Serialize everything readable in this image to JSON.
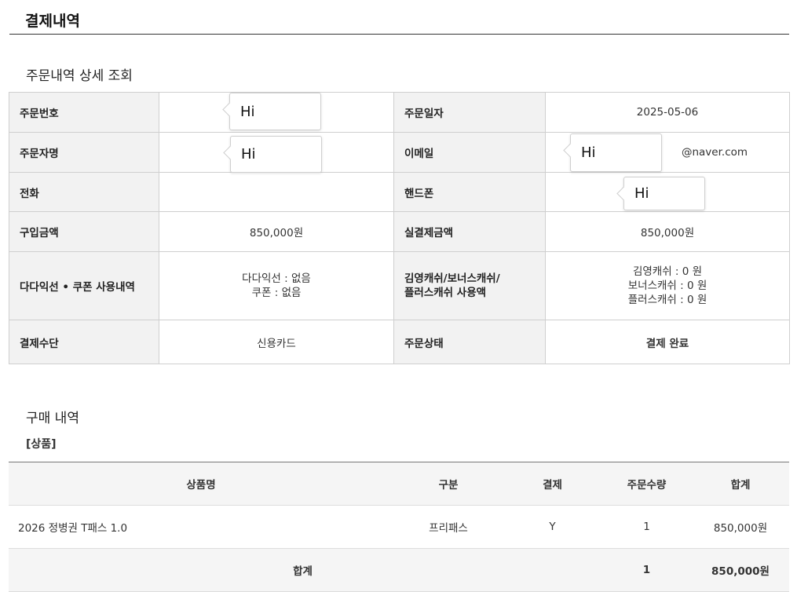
{
  "page_title": "결제내역",
  "section_title": "주문내역 상세 조회",
  "order": {
    "order_no_label": "주문번호",
    "order_date_label": "주문일자",
    "order_date": "2025-05-06",
    "orderer_label": "주문자명",
    "email_label": "이메일",
    "email_visible": "@naver.com",
    "phone_label": "전화",
    "phone": "",
    "mobile_label": "핸드폰",
    "purchase_amount_label": "구입금액",
    "purchase_amount": "850,000원",
    "actual_payment_label": "실결제금액",
    "actual_payment": "850,000원",
    "coupon_label": "다다익선 • 쿠폰 사용내역",
    "coupon_line1": "다다익선 : 없음",
    "coupon_line2": "쿠폰 : 없음",
    "cash_label_line1": "김영캐쉬/보너스캐쉬/",
    "cash_label_line2": "플러스캐쉬 사용액",
    "cash_line1": "김영캐쉬 : 0 원",
    "cash_line2": "보너스캐쉬 : 0 원",
    "cash_line3": "플러스캐쉬 : 0 원",
    "payment_method_label": "결제수단",
    "payment_method": "신용카드",
    "order_status_label": "주문상태",
    "order_status": "결제 완료"
  },
  "bubbles": {
    "order_no": "Hi",
    "orderer": "Hi",
    "email": "Hi",
    "mobile": "Hi"
  },
  "purchase_title": "구매 내역",
  "product_tag": "[상품]",
  "items_table": {
    "headers": [
      "상품명",
      "구분",
      "결제",
      "주문수량",
      "합계"
    ],
    "rows": [
      [
        "2026 정병권 T패스 1.0",
        "프리패스",
        "Y",
        "1",
        "850,000원"
      ]
    ],
    "total": {
      "label": "합계",
      "qty": "1",
      "amount": "850,000원"
    }
  },
  "colors": {
    "accent": "#e8590c",
    "label_bg": "#f2f2f2",
    "border": "#cfcfcf"
  }
}
